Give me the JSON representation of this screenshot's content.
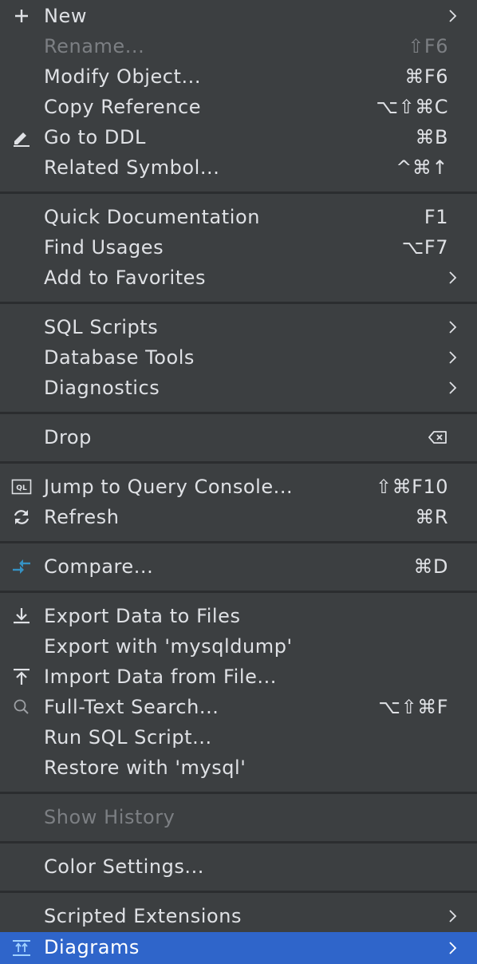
{
  "menu": {
    "new_label": "New",
    "rename_label": "Rename...",
    "rename_shortcut": "⇧F6",
    "modify_label": "Modify Object...",
    "modify_shortcut": "⌘F6",
    "copyref_label": "Copy Reference",
    "copyref_shortcut": "⌥⇧⌘C",
    "goto_ddl_label": "Go to DDL",
    "goto_ddl_shortcut": "⌘B",
    "related_label": "Related Symbol...",
    "related_shortcut": "^⌘↑",
    "quickdoc_label": "Quick Documentation",
    "quickdoc_shortcut": "F1",
    "findusages_label": "Find Usages",
    "findusages_shortcut": "⌥F7",
    "favorites_label": "Add to Favorites",
    "sqlscripts_label": "SQL Scripts",
    "dbtools_label": "Database Tools",
    "diagnostics_label": "Diagnostics",
    "drop_label": "Drop",
    "jumpconsole_label": "Jump to Query Console...",
    "jumpconsole_shortcut": "⇧⌘F10",
    "refresh_label": "Refresh",
    "refresh_shortcut": "⌘R",
    "compare_label": "Compare...",
    "compare_shortcut": "⌘D",
    "export_label": "Export Data to Files",
    "exportdump_label": "Export with 'mysqldump'",
    "import_label": "Import Data from File...",
    "fulltext_label": "Full-Text Search...",
    "fulltext_shortcut": "⌥⇧⌘F",
    "runsql_label": "Run SQL Script...",
    "restore_label": "Restore with 'mysql'",
    "history_label": "Show History",
    "color_label": "Color Settings...",
    "scripted_label": "Scripted Extensions",
    "diagrams_label": "Diagrams",
    "icon_ql_text": "QL"
  },
  "colors": {
    "background": "#3c3f41",
    "separator": "#2b2d2f",
    "text": "#dfe1e5",
    "disabled_text": "#7c7f83",
    "selected_bg": "#2f65ca",
    "accent_blue": "#3592c4"
  }
}
